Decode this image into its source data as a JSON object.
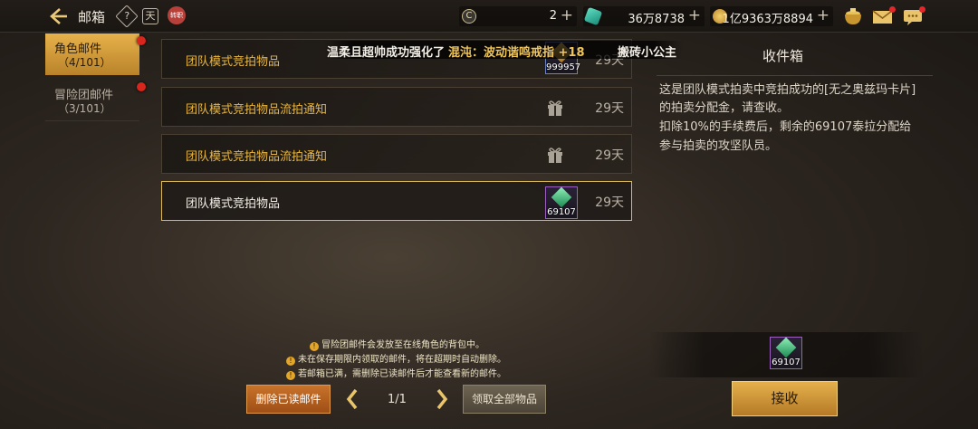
{
  "header": {
    "title": "邮箱",
    "help_icon": "?",
    "calendar_icon": "天",
    "badge_icon": "转职",
    "currencies": [
      {
        "icon": "C",
        "value": "2"
      },
      {
        "icon": "crystal-icon",
        "value": "36万8738"
      },
      {
        "icon": "gold-coin-icon",
        "value": "1亿9363万8894"
      }
    ]
  },
  "tabs": [
    {
      "name": "角色邮件",
      "count": "（4/101）",
      "active": true
    },
    {
      "name": "冒险团邮件",
      "count": "（3/101）",
      "active": false
    }
  ],
  "broadcast": {
    "prefix": "温柔且超帅成功强化了",
    "item": "混沌：波动谐鸣戒指 +18",
    "user": "搬砖小公主"
  },
  "mails": [
    {
      "title": "团队模式竞拍物品",
      "days": "29天",
      "attachment": "item",
      "quantity": "999957",
      "selected": false
    },
    {
      "title": "团队模式竞拍物品流拍通知",
      "days": "29天",
      "attachment": "gift",
      "selected": false
    },
    {
      "title": "团队模式竞拍物品流拍通知",
      "days": "29天",
      "attachment": "gift",
      "selected": false
    },
    {
      "title": "团队模式竞拍物品",
      "days": "29天",
      "attachment": "item",
      "quantity": "69107",
      "selected": true
    }
  ],
  "detail": {
    "heading": "收件箱",
    "line1": "这是团队模式拍卖中竞拍成功的[无之奥兹玛卡片]",
    "line2": "的拍卖分配金，请查收。",
    "line3": "扣除10%的手续费后，剩余的69107泰拉分配给",
    "line4": "参与拍卖的攻坚队员。",
    "attachment_quantity": "69107",
    "receive_label": "接收"
  },
  "notices": [
    "冒险团邮件会发放至在线角色的背包中。",
    "未在保存期限内领取的邮件，将在超期时自动删除。",
    "若邮箱已满，需删除已读邮件后才能查看新的邮件。"
  ],
  "footer": {
    "delete_read_label": "删除已读邮件",
    "page": "1/1",
    "claim_all_label": "领取全部物品"
  }
}
